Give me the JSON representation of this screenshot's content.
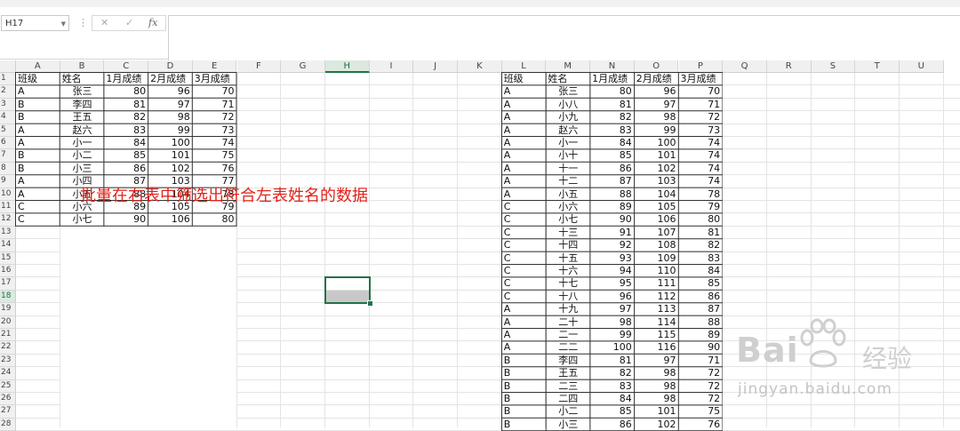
{
  "formula_bar": {
    "name_box": "H17",
    "cancel_icon": "✕",
    "confirm_icon": "✓",
    "fx_label": "fx",
    "formula_value": ""
  },
  "columns": [
    "A",
    "B",
    "C",
    "D",
    "E",
    "F",
    "G",
    "H",
    "I",
    "J",
    "K",
    "L",
    "M",
    "N",
    "O",
    "P",
    "Q",
    "R",
    "S",
    "T",
    "U"
  ],
  "selected_column": "H",
  "rows": [
    "1",
    "2",
    "3",
    "4",
    "5",
    "6",
    "7",
    "8",
    "9",
    "10",
    "11",
    "12",
    "13",
    "14",
    "15",
    "16",
    "17",
    "18",
    "19",
    "20",
    "21",
    "22",
    "23",
    "24",
    "25",
    "26",
    "27",
    "28"
  ],
  "selected_row": "18",
  "left_table": {
    "headers": [
      "班级",
      "姓名",
      "1月成绩",
      "2月成绩",
      "3月成绩"
    ],
    "rows": [
      [
        "A",
        "张三",
        "80",
        "96",
        "70"
      ],
      [
        "B",
        "李四",
        "81",
        "97",
        "71"
      ],
      [
        "B",
        "王五",
        "82",
        "98",
        "72"
      ],
      [
        "A",
        "赵六",
        "83",
        "99",
        "73"
      ],
      [
        "A",
        "小一",
        "84",
        "100",
        "74"
      ],
      [
        "B",
        "小二",
        "85",
        "101",
        "75"
      ],
      [
        "B",
        "小三",
        "86",
        "102",
        "76"
      ],
      [
        "A",
        "小四",
        "87",
        "103",
        "77"
      ],
      [
        "A",
        "小五",
        "88",
        "104",
        "78"
      ],
      [
        "C",
        "小六",
        "89",
        "105",
        "79"
      ],
      [
        "C",
        "小七",
        "90",
        "106",
        "80"
      ]
    ]
  },
  "right_table": {
    "headers": [
      "班级",
      "姓名",
      "1月成绩",
      "2月成绩",
      "3月成绩"
    ],
    "rows": [
      [
        "A",
        "张三",
        "80",
        "96",
        "70"
      ],
      [
        "A",
        "小八",
        "81",
        "97",
        "71"
      ],
      [
        "A",
        "小九",
        "82",
        "98",
        "72"
      ],
      [
        "A",
        "赵六",
        "83",
        "99",
        "73"
      ],
      [
        "A",
        "小一",
        "84",
        "100",
        "74"
      ],
      [
        "A",
        "小十",
        "85",
        "101",
        "74"
      ],
      [
        "A",
        "十一",
        "86",
        "102",
        "74"
      ],
      [
        "A",
        "十二",
        "87",
        "103",
        "74"
      ],
      [
        "A",
        "小五",
        "88",
        "104",
        "78"
      ],
      [
        "C",
        "小六",
        "89",
        "105",
        "79"
      ],
      [
        "C",
        "小七",
        "90",
        "106",
        "80"
      ],
      [
        "C",
        "十三",
        "91",
        "107",
        "81"
      ],
      [
        "C",
        "十四",
        "92",
        "108",
        "82"
      ],
      [
        "C",
        "十五",
        "93",
        "109",
        "83"
      ],
      [
        "C",
        "十六",
        "94",
        "110",
        "84"
      ],
      [
        "C",
        "十七",
        "95",
        "111",
        "85"
      ],
      [
        "C",
        "十八",
        "96",
        "112",
        "86"
      ],
      [
        "A",
        "十九",
        "97",
        "113",
        "87"
      ],
      [
        "A",
        "二十",
        "98",
        "114",
        "88"
      ],
      [
        "A",
        "二一",
        "99",
        "115",
        "89"
      ],
      [
        "A",
        "二二",
        "100",
        "116",
        "90"
      ],
      [
        "B",
        "李四",
        "81",
        "97",
        "71"
      ],
      [
        "B",
        "王五",
        "82",
        "98",
        "72"
      ],
      [
        "B",
        "二三",
        "83",
        "98",
        "72"
      ],
      [
        "B",
        "二四",
        "84",
        "98",
        "72"
      ],
      [
        "B",
        "小二",
        "85",
        "101",
        "75"
      ],
      [
        "B",
        "小三",
        "86",
        "102",
        "76"
      ]
    ]
  },
  "annotation": "批量在右表中筛选出符合左表姓名的数据",
  "watermark": {
    "brand_left": "Bai",
    "brand_right": "经验",
    "url": "jingyan.baidu.com"
  },
  "colors": {
    "accent": "#217346",
    "annotation": "#e2231a",
    "selected_fill": "#c8c8c8"
  }
}
